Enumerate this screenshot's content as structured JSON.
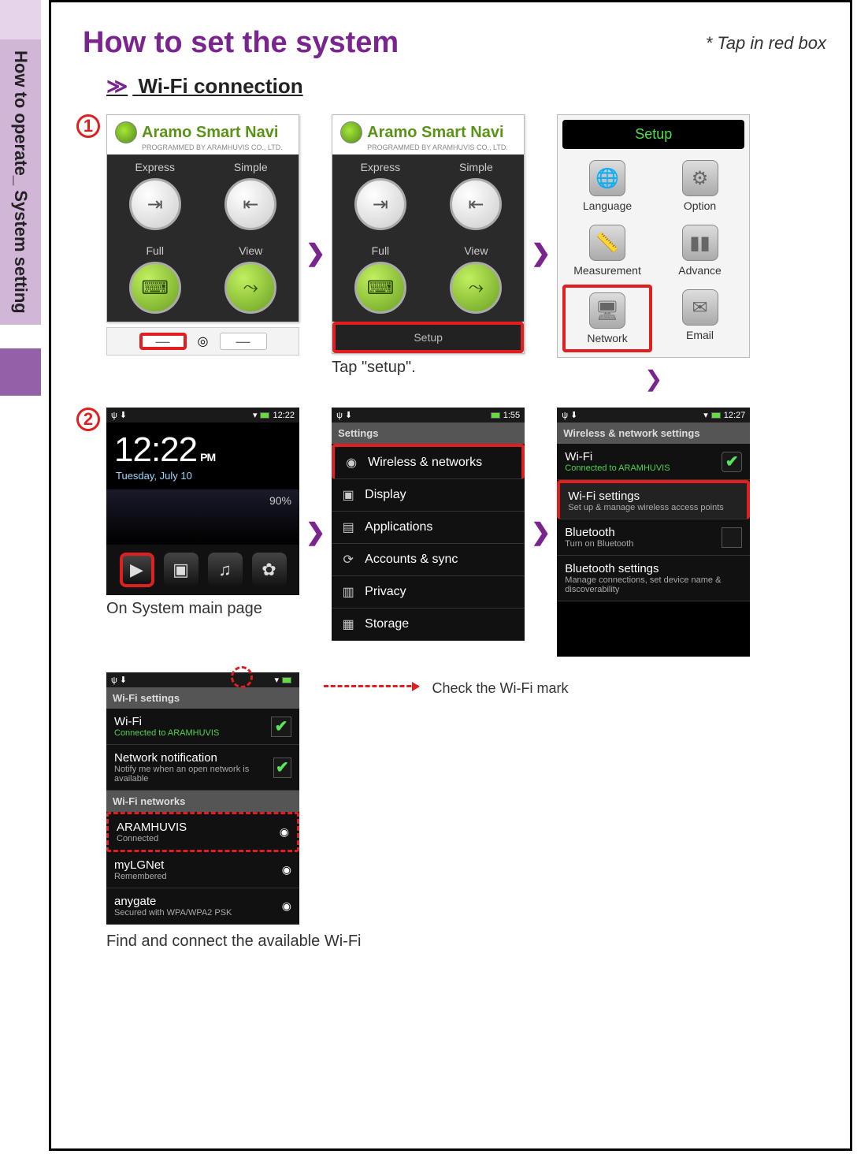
{
  "side_tab": "How to operate_ System setting",
  "page_title": "How to set the system",
  "tap_hint": "* Tap in red box",
  "section_subtitle": "Wi-Fi connection",
  "step1_marker": "1",
  "step2_marker": "2",
  "navi": {
    "title": "Aramo Smart Navi",
    "subtitle": "PROGRAMMED BY ARAMHUVIS CO., LTD.",
    "cells": {
      "express": "Express",
      "simple": "Simple",
      "full": "Full",
      "view": "View"
    },
    "footer": "Setup"
  },
  "caption_tap_setup": "Tap \"setup\".",
  "setup_menu": {
    "title": "Setup",
    "items": {
      "language": "Language",
      "option": "Option",
      "measurement": "Measurement",
      "advance": "Advance",
      "network": "Network",
      "email": "Email"
    }
  },
  "home": {
    "time": "12:22",
    "ampm": "PM",
    "date": "Tuesday, July 10",
    "battery_pct": "90%",
    "status_time": "12:22"
  },
  "caption_main_page": "On System main page",
  "settings": {
    "status_time": "1:55",
    "header": "Settings",
    "items": {
      "wireless": "Wireless & networks",
      "display": "Display",
      "applications": "Applications",
      "accounts": "Accounts & sync",
      "privacy": "Privacy",
      "storage": "Storage"
    }
  },
  "wns": {
    "status_time": "12:27",
    "header": "Wireless & network settings",
    "wifi": {
      "title": "Wi-Fi",
      "sub": "Connected to ARAMHUVIS"
    },
    "wifi_settings": {
      "title": "Wi-Fi settings",
      "sub": "Set up & manage wireless access points"
    },
    "bt": {
      "title": "Bluetooth",
      "sub": "Turn on Bluetooth"
    },
    "bt_settings": {
      "title": "Bluetooth settings",
      "sub": "Manage connections, set device name & discoverability"
    }
  },
  "wifi_page": {
    "header": "Wi-Fi settings",
    "networks_header": "Wi-Fi networks",
    "wifi": {
      "title": "Wi-Fi",
      "sub": "Connected to ARAMHUVIS"
    },
    "notify": {
      "title": "Network notification",
      "sub": "Notify me when an open network is available"
    },
    "ap1": {
      "name": "ARAMHUVIS",
      "sub": "Connected"
    },
    "ap2": {
      "name": "myLGNet",
      "sub": "Remembered"
    },
    "ap3": {
      "name": "anygate",
      "sub": "Secured with WPA/WPA2 PSK"
    }
  },
  "caption_check_mark": "Check the Wi-Fi mark",
  "caption_find_connect": "Find and connect the available Wi-Fi"
}
